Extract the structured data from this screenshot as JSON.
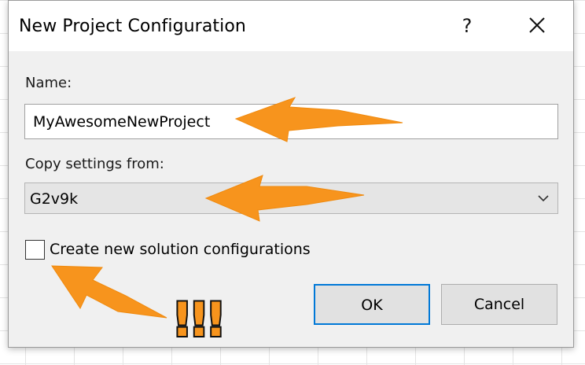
{
  "dialog": {
    "title": "New Project Configuration",
    "help_glyph": "?",
    "close_glyph": "×"
  },
  "name_field": {
    "label": "Name:",
    "value": "MyAwesomeNewProject"
  },
  "copy_settings": {
    "label": "Copy settings from:",
    "selected": "G2v9k"
  },
  "checkbox": {
    "label": "Create new solution configurations",
    "checked": false
  },
  "buttons": {
    "ok_label": "OK",
    "cancel_label": "Cancel"
  },
  "annotation": {
    "exclaim": "!!!",
    "arrow_color": "#f7941d"
  },
  "colors": {
    "dialog_bg": "#f0f0f0",
    "accent_focus": "#0078d7",
    "arrow": "#f7941d"
  }
}
